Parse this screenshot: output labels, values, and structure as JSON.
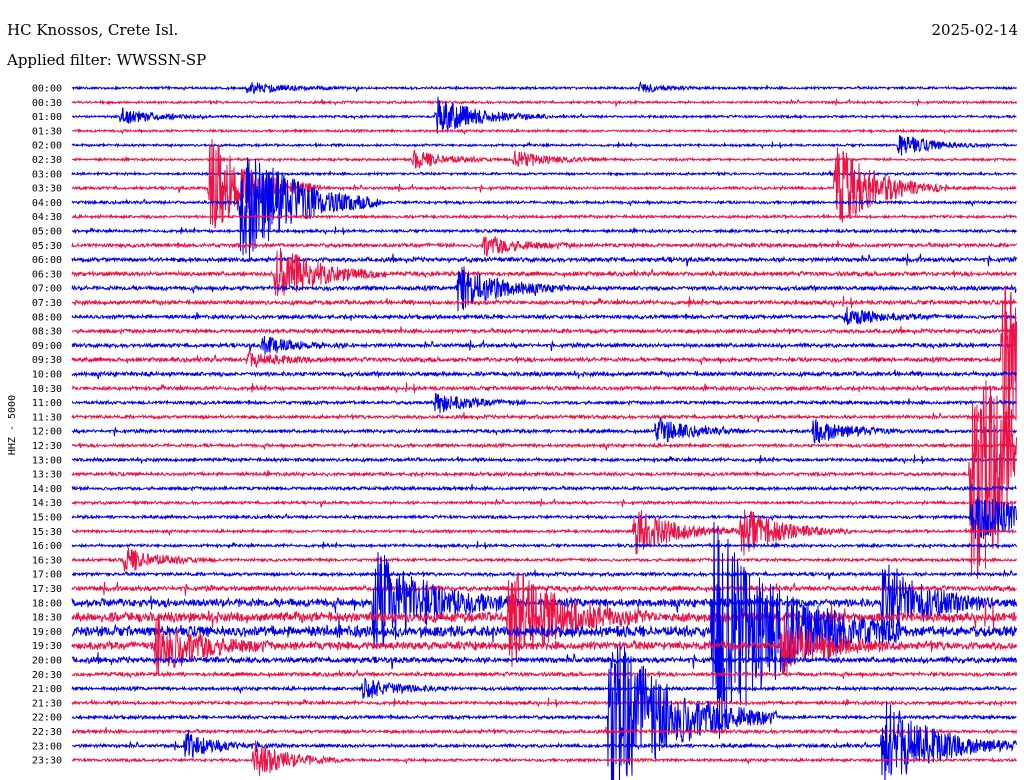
{
  "header": {
    "station": "HC Knossos, Crete Isl.",
    "date": "2025-02-14",
    "filter": "Applied filter: WWSSN-SP"
  },
  "colors": {
    "trace_a": "#0000ee",
    "trace_b": "#ee1145"
  },
  "chart_data": {
    "type": "line",
    "title": "HC Knossos, Crete Isl.",
    "ylabel": "HHZ - 5000",
    "xlabel": "",
    "row_labels": [
      "00:00",
      "00:30",
      "01:00",
      "01:30",
      "02:00",
      "02:30",
      "03:00",
      "03:30",
      "04:00",
      "04:30",
      "05:00",
      "05:30",
      "06:00",
      "06:30",
      "07:00",
      "07:30",
      "08:00",
      "08:30",
      "09:00",
      "09:30",
      "10:00",
      "10:30",
      "11:00",
      "11:30",
      "12:00",
      "12:30",
      "13:00",
      "13:30",
      "14:00",
      "14:30",
      "15:00",
      "15:30",
      "16:00",
      "16:30",
      "17:00",
      "17:30",
      "18:00",
      "18:30",
      "19:00",
      "19:30",
      "20:00",
      "20:30",
      "21:00",
      "21:30",
      "22:00",
      "22:30",
      "23:00",
      "23:30"
    ],
    "row_colors": "alternating trace_a / trace_b",
    "x_range_minutes": [
      0,
      30
    ],
    "noise_level_by_row": [
      1,
      1,
      1,
      1,
      1,
      1,
      1,
      1.2,
      1.2,
      1.2,
      1.2,
      1.6,
      1.8,
      1.8,
      1.8,
      1.8,
      1.6,
      1.6,
      1.6,
      1.8,
      1.8,
      1.6,
      1.4,
      1.4,
      1.4,
      1.4,
      1.4,
      1.4,
      1.4,
      1.2,
      1.2,
      1.2,
      1.2,
      1.2,
      1.4,
      2.0,
      3.6,
      4.2,
      4.6,
      3.4,
      2.4,
      1.6,
      1.4,
      1.4,
      1.4,
      1.4,
      1.4,
      1.2
    ],
    "events": [
      {
        "row": 0,
        "x_min": 5.5,
        "amp": 6,
        "dur_min": 1.2
      },
      {
        "row": 0,
        "x_min": 18.0,
        "amp": 6,
        "dur_min": 0.6
      },
      {
        "row": 2,
        "x_min": 1.5,
        "amp": 9,
        "dur_min": 1.0
      },
      {
        "row": 2,
        "x_min": 11.5,
        "amp": 22,
        "dur_min": 1.2
      },
      {
        "row": 4,
        "x_min": 26.2,
        "amp": 12,
        "dur_min": 1.0
      },
      {
        "row": 5,
        "x_min": 10.8,
        "amp": 10,
        "dur_min": 1.0
      },
      {
        "row": 5,
        "x_min": 14.0,
        "amp": 10,
        "dur_min": 1.0
      },
      {
        "row": 7,
        "x_min": 4.3,
        "amp": 58,
        "dur_min": 1.2
      },
      {
        "row": 7,
        "x_min": 24.2,
        "amp": 48,
        "dur_min": 1.2
      },
      {
        "row": 8,
        "x_min": 5.3,
        "amp": 72,
        "dur_min": 1.5
      },
      {
        "row": 11,
        "x_min": 13.0,
        "amp": 12,
        "dur_min": 1.0
      },
      {
        "row": 13,
        "x_min": 6.4,
        "amp": 34,
        "dur_min": 1.2
      },
      {
        "row": 14,
        "x_min": 12.2,
        "amp": 26,
        "dur_min": 1.2
      },
      {
        "row": 16,
        "x_min": 24.5,
        "amp": 10,
        "dur_min": 1.0
      },
      {
        "row": 18,
        "x_min": 6.0,
        "amp": 10,
        "dur_min": 1.0
      },
      {
        "row": 19,
        "x_min": 5.5,
        "amp": 8,
        "dur_min": 1.0
      },
      {
        "row": 19,
        "x_min": 29.5,
        "amp": 85,
        "dur_min": 2.0
      },
      {
        "row": 22,
        "x_min": 11.5,
        "amp": 12,
        "dur_min": 1.0
      },
      {
        "row": 24,
        "x_min": 18.5,
        "amp": 14,
        "dur_min": 1.0
      },
      {
        "row": 24,
        "x_min": 23.5,
        "amp": 14,
        "dur_min": 1.0
      },
      {
        "row": 27,
        "x_min": 28.5,
        "amp": 120,
        "dur_min": 2.2
      },
      {
        "row": 30,
        "x_min": 28.5,
        "amp": 30,
        "dur_min": 1.5
      },
      {
        "row": 31,
        "x_min": 17.8,
        "amp": 26,
        "dur_min": 1.2
      },
      {
        "row": 31,
        "x_min": 21.2,
        "amp": 26,
        "dur_min": 1.2
      },
      {
        "row": 33,
        "x_min": 1.6,
        "amp": 14,
        "dur_min": 1.0
      },
      {
        "row": 36,
        "x_min": 9.5,
        "amp": 60,
        "dur_min": 1.5
      },
      {
        "row": 36,
        "x_min": 25.7,
        "amp": 48,
        "dur_min": 1.2
      },
      {
        "row": 37,
        "x_min": 13.8,
        "amp": 55,
        "dur_min": 1.5
      },
      {
        "row": 38,
        "x_min": 20.3,
        "amp": 120,
        "dur_min": 2.0
      },
      {
        "row": 39,
        "x_min": 2.6,
        "amp": 34,
        "dur_min": 1.2
      },
      {
        "row": 39,
        "x_min": 22.5,
        "amp": 30,
        "dur_min": 1.2
      },
      {
        "row": 42,
        "x_min": 9.2,
        "amp": 12,
        "dur_min": 1.0
      },
      {
        "row": 44,
        "x_min": 17.0,
        "amp": 95,
        "dur_min": 1.8
      },
      {
        "row": 46,
        "x_min": 3.5,
        "amp": 14,
        "dur_min": 1.0
      },
      {
        "row": 46,
        "x_min": 25.7,
        "amp": 50,
        "dur_min": 1.5
      },
      {
        "row": 47,
        "x_min": 5.7,
        "amp": 22,
        "dur_min": 1.0
      }
    ]
  }
}
